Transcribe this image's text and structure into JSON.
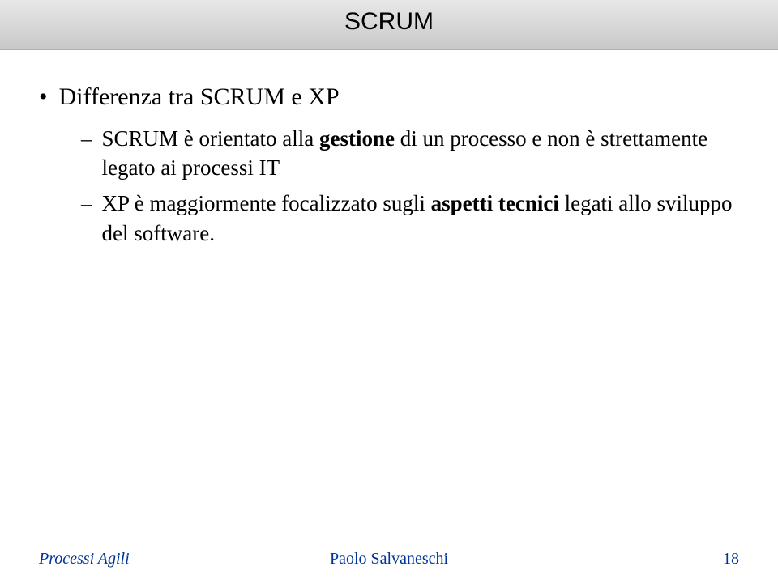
{
  "title": "SCRUM",
  "bullets": {
    "level1": "Differenza tra SCRUM e XP",
    "level2": [
      {
        "prefix": "SCRUM è orientato alla ",
        "bold1": "gestione",
        "mid": " di un processo e non è strettamente legato ai processi IT"
      },
      {
        "prefix": "XP è maggiormente focalizzato sugli ",
        "bold1": "aspetti tecnici",
        "mid": " legati allo sviluppo del software."
      }
    ]
  },
  "footer": {
    "left": "Processi Agili",
    "center": "Paolo Salvaneschi",
    "right": "18"
  }
}
